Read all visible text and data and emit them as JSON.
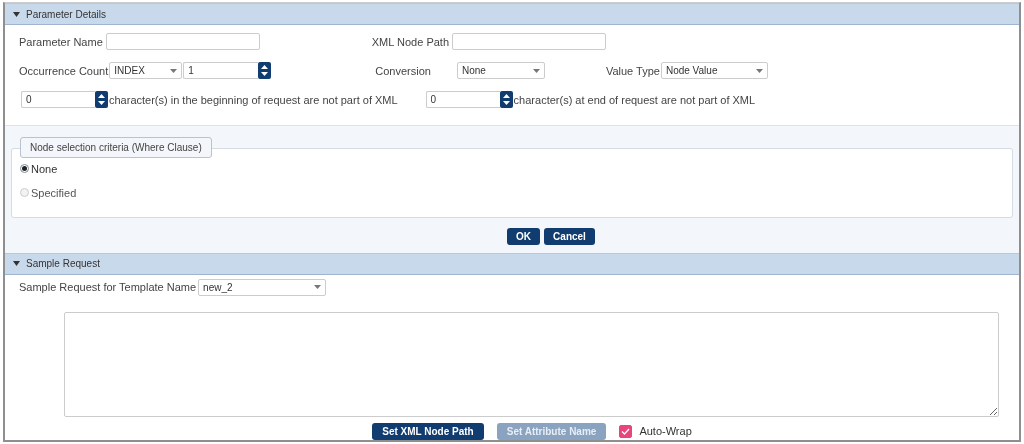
{
  "parameter_details": {
    "title": "Parameter Details",
    "expanded": true,
    "parameter_name": {
      "label": "Parameter Name"
    },
    "xml_node_path": {
      "label": "XML Node Path"
    },
    "occurrence_count": {
      "label": "Occurrence Count",
      "mode": "INDEX",
      "value": "1"
    },
    "conversion": {
      "label": "Conversion",
      "value": "None"
    },
    "value_type": {
      "label": "Value Type",
      "value": "Node Value"
    },
    "begin_chars": {
      "value": "0",
      "label": "character(s) in the beginning of request are not part of XML"
    },
    "end_chars": {
      "value": "0",
      "label": "character(s) at end of request are not part of XML"
    },
    "criteria": {
      "title": "Node selection criteria (Where Clause)",
      "options": [
        {
          "label": "None",
          "selected": true,
          "disabled": false
        },
        {
          "label": "Specified",
          "selected": false,
          "disabled": true
        }
      ]
    },
    "buttons": [
      {
        "label": "OK",
        "disabled": false
      },
      {
        "label": "Cancel",
        "disabled": false
      }
    ]
  },
  "sample_request": {
    "title": "Sample Request",
    "expanded": true,
    "template": {
      "label": "Sample Request for Template Name",
      "value": "new_2"
    },
    "buttons": [
      {
        "label": "Set XML Node Path",
        "disabled": false
      },
      {
        "label": "Set Attribute Name",
        "disabled": true
      }
    ],
    "auto_wrap": {
      "label": "Auto-Wrap",
      "checked": true
    }
  }
}
